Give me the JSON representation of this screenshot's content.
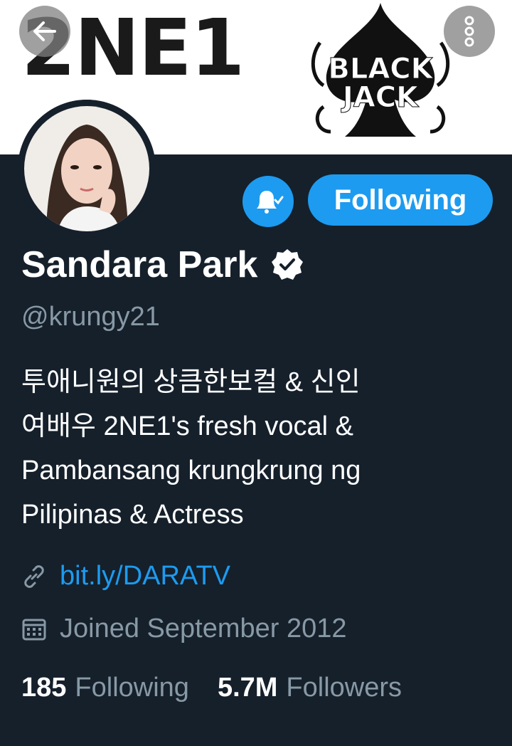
{
  "banner": {
    "brand_text": "2NE1",
    "logo_line1": "BLACK",
    "logo_line2": "JACK"
  },
  "header": {
    "back_icon": "back-arrow-icon",
    "more_icon": "more-vertical-icon"
  },
  "actions": {
    "notify_icon": "bell-check-icon",
    "following_label": "Following"
  },
  "profile": {
    "name": "Sandara Park",
    "verified_icon": "verified-badge-icon",
    "handle": "@krungy21",
    "bio_lines": [
      "투애니원의 상큼한보컬 & 신인",
      "여배우 2NE1's fresh vocal &",
      "Pambansang krungkrung ng",
      "Pilipinas & Actress"
    ],
    "link": "bit.ly/DARATV",
    "link_icon": "link-icon",
    "joined": "Joined September 2012",
    "joined_icon": "calendar-icon"
  },
  "stats": {
    "following_count": "185",
    "following_label": "Following",
    "followers_count": "5.7M",
    "followers_label": "Followers"
  },
  "colors": {
    "background": "#15202b",
    "accent": "#1d9bf0",
    "muted": "#8899a6"
  }
}
